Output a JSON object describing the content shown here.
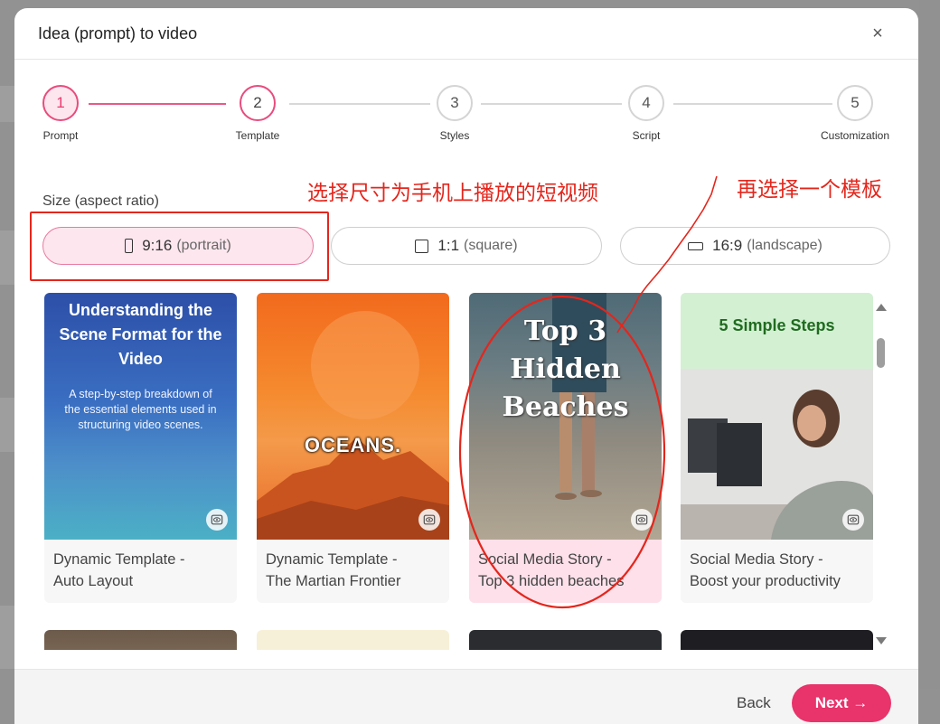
{
  "modal": {
    "title": "Idea (prompt) to video",
    "close": "×"
  },
  "steps": [
    {
      "num": "1",
      "label": "Prompt"
    },
    {
      "num": "2",
      "label": "Template"
    },
    {
      "num": "3",
      "label": "Styles"
    },
    {
      "num": "4",
      "label": "Script"
    },
    {
      "num": "5",
      "label": "Customization"
    }
  ],
  "size": {
    "label": "Size (aspect ratio)",
    "options": [
      {
        "ratio": "9:16",
        "desc": "(portrait)"
      },
      {
        "ratio": "1:1",
        "desc": "(square)"
      },
      {
        "ratio": "16:9",
        "desc": "(landscape)"
      }
    ],
    "selected": "9:16"
  },
  "templates": [
    {
      "caption_line1": "Dynamic Template -",
      "caption_line2": "Auto Layout",
      "thumb_title": "Understanding the Scene Format for the Video",
      "thumb_body": "A step-by-step breakdown of the essential elements used in structuring video scenes."
    },
    {
      "caption_line1": "Dynamic Template -",
      "caption_line2": "The Martian Frontier",
      "thumb_title": "OCEANS."
    },
    {
      "caption_line1": "Social Media Story -",
      "caption_line2": "Top 3 hidden beaches",
      "thumb_title": "Top 3 Hidden Beaches"
    },
    {
      "caption_line1": "Social Media Story -",
      "caption_line2": "Boost your productivity",
      "thumb_title": "5 Simple Steps"
    }
  ],
  "footer": {
    "back": "Back",
    "next": "Next →"
  },
  "annotations": {
    "size_note": "选择尺寸为手机上播放的短视频",
    "template_note": "再选择一个模板"
  },
  "colors": {
    "accent": "#e8336b",
    "annotation": "#e4261c",
    "selected_bg": "#fde6ee"
  }
}
